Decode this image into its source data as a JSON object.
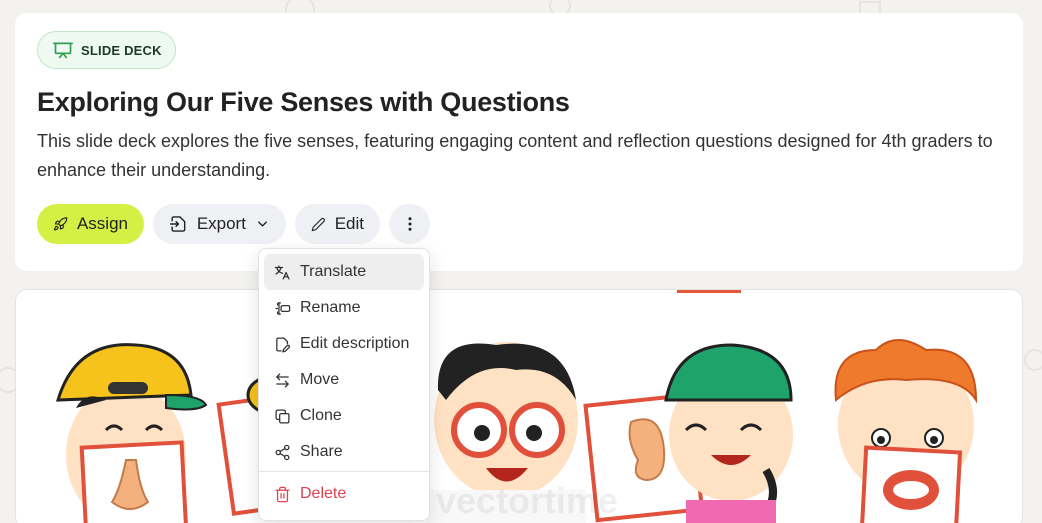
{
  "header": {
    "badge_label": "SLIDE DECK",
    "title": "Exploring Our Five Senses with Questions",
    "description": "This slide deck explores the five senses, featuring engaging content and reflection questions designed for 4th graders to enhance their understanding."
  },
  "actions": {
    "assign_label": "Assign",
    "export_label": "Export",
    "edit_label": "Edit"
  },
  "menu": {
    "items": [
      {
        "label": "Translate",
        "icon": "translate-icon"
      },
      {
        "label": "Rename",
        "icon": "rename-icon"
      },
      {
        "label": "Edit description",
        "icon": "edit-description-icon"
      },
      {
        "label": "Move",
        "icon": "move-icon"
      },
      {
        "label": "Clone",
        "icon": "clone-icon"
      },
      {
        "label": "Share",
        "icon": "share-icon"
      }
    ],
    "delete_label": "Delete"
  },
  "preview": {
    "watermark": "vectortime"
  },
  "colors": {
    "accent": "#d4f045",
    "badge_green": "#2f9e4f",
    "danger": "#e0424f",
    "preview_orange": "#e55a3c"
  }
}
